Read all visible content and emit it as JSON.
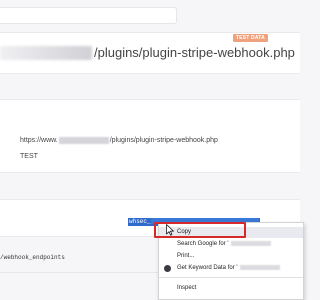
{
  "header": {
    "search_value": ""
  },
  "url_card": {
    "badge": "TEST DATA",
    "url_suffix": "/plugins/plugin-stripe-webhook.php"
  },
  "info_card": {
    "url_prefix": "https://www.",
    "url_suffix": "/plugins/plugin-stripe-webhook.php",
    "mode": "TEST"
  },
  "secret_card": {
    "secret_prefix": "whsec_"
  },
  "endpoints": {
    "path": "/webhook_endpoints"
  },
  "context_menu": {
    "items": [
      {
        "label": "Copy"
      },
      {
        "label": "Search Google for '"
      },
      {
        "label": "Print..."
      },
      {
        "label": "Get Keyword Data for '"
      },
      {
        "label": "Inspect"
      }
    ]
  },
  "colors": {
    "selection": "#2f69c9",
    "badge": "#f0a27e",
    "highlight_border": "#d62a2a"
  },
  "icons": {
    "keyword": "keyword-extension-icon",
    "cursor": "mouse-cursor-icon"
  }
}
